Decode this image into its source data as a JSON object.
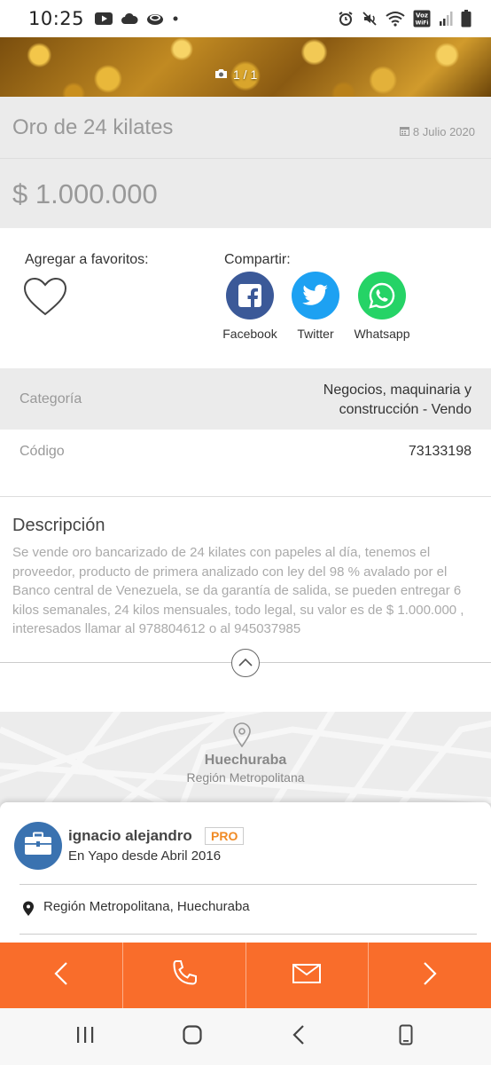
{
  "status_bar": {
    "time": "10:25",
    "icons_left": [
      "youtube-icon",
      "cloud-icon",
      "app-icon",
      "dot-icon"
    ],
    "icons_right": [
      "alarm-icon",
      "mute-icon",
      "wifi-icon",
      "volte-icon",
      "signal-icon",
      "battery-icon"
    ],
    "volte_text": "Voz WiFi"
  },
  "gallery": {
    "counter": "1 / 1"
  },
  "listing": {
    "title": "Oro de 24 kilates",
    "date": "8 Julio 2020",
    "price": "$ 1.000.000"
  },
  "favorites": {
    "label": "Agregar a favoritos:"
  },
  "share": {
    "label": "Compartir:",
    "items": [
      {
        "label": "Facebook",
        "color": "#3b5998"
      },
      {
        "label": "Twitter",
        "color": "#1da1f2"
      },
      {
        "label": "Whatsapp",
        "color": "#25d366"
      }
    ]
  },
  "details": {
    "category_key": "Categoría",
    "category_value": "Negocios, maquinaria y construcción - Vendo",
    "code_key": "Código",
    "code_value": "73133198"
  },
  "description": {
    "title": "Descripción",
    "text": "Se vende oro bancarizado de 24 kilates con papeles al día, tenemos el proveedor, producto de primera analizado con ley del 98 % avalado por el Banco central de Venezuela, se da garantía de salida, se pueden entregar 6 kilos semanales, 24 kilos mensuales, todo legal, su valor es de $ 1.000.000 , interesados llamar al 978804612 o al 945037985"
  },
  "map": {
    "commune": "Huechuraba",
    "region": "Región Metropolitana"
  },
  "seller": {
    "name": "ignacio alejandro",
    "badge": "PRO",
    "since": "En Yapo desde Abril 2016",
    "location": "Región Metropolitana, Huechuraba"
  },
  "actions": [
    "previous-icon",
    "phone-icon",
    "mail-icon",
    "next-icon"
  ],
  "colors": {
    "accent": "#f96d2b",
    "badge": "#f08a24",
    "avatar": "#3a72b0"
  }
}
